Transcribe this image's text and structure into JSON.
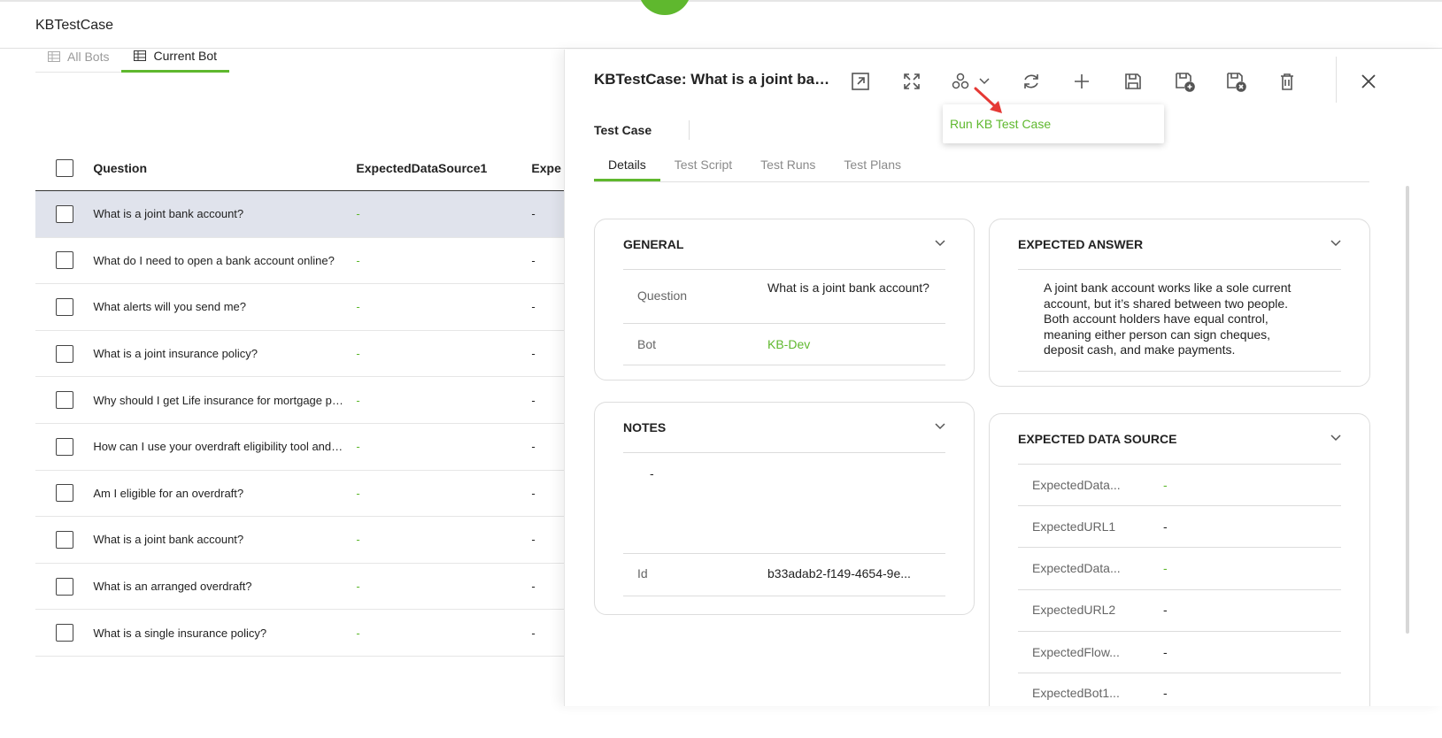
{
  "app": {
    "title": "KBTestCase"
  },
  "list": {
    "tabs": [
      {
        "label": "All Bots",
        "active": false
      },
      {
        "label": "Current Bot",
        "active": true
      }
    ],
    "columns": [
      "Question",
      "ExpectedDataSource1",
      "Expe"
    ],
    "rows": [
      {
        "question": "What is a joint bank account?",
        "ds1": "-",
        "expe": "-",
        "selected": true
      },
      {
        "question": "What do I need to open a bank account online?",
        "ds1": "-",
        "expe": "-"
      },
      {
        "question": "What alerts will you send me?",
        "ds1": "-",
        "expe": "-"
      },
      {
        "question": "What is a joint insurance policy?",
        "ds1": "-",
        "expe": "-"
      },
      {
        "question": "Why should I get Life insurance for mortgage protection?",
        "ds1": "-",
        "expe": "-"
      },
      {
        "question": "How can I use your overdraft eligibility tool and what does it do?",
        "ds1": "-",
        "expe": "-"
      },
      {
        "question": "Am I eligible for an overdraft?",
        "ds1": "-",
        "expe": "-"
      },
      {
        "question": "What is a joint bank account?",
        "ds1": "-",
        "expe": "-"
      },
      {
        "question": "What is an arranged overdraft?",
        "ds1": "-",
        "expe": "-"
      },
      {
        "question": "What is a single insurance policy?",
        "ds1": "-",
        "expe": "-"
      }
    ]
  },
  "panel": {
    "title": "KBTestCase: What is a joint bank account?",
    "subtitle": "Test Case",
    "toolbar_icons": [
      "open-external-icon",
      "expand-icon",
      "flow-icon",
      "refresh-icon",
      "add-icon",
      "save-icon",
      "save-add-icon",
      "save-close-icon",
      "delete-icon",
      "close-icon"
    ],
    "dropdown_item": "Run KB Test Case",
    "tabs": [
      {
        "label": "Details",
        "active": true
      },
      {
        "label": "Test Script"
      },
      {
        "label": "Test Runs"
      },
      {
        "label": "Test Plans"
      }
    ],
    "general": {
      "header": "GENERAL",
      "question_label": "Question",
      "question_value": "What is a joint bank account?",
      "bot_label": "Bot",
      "bot_value": "KB-Dev"
    },
    "notes": {
      "header": "NOTES",
      "value": "-",
      "id_label": "Id",
      "id_value": "b33adab2-f149-4654-9e..."
    },
    "expected_answer": {
      "header": "EXPECTED ANSWER",
      "text": "A joint bank account works like a sole current account, but it’s shared between two people. Both account holders have equal control, meaning either person can sign cheques, deposit cash, and make payments."
    },
    "expected_data_source": {
      "header": "EXPECTED DATA SOURCE",
      "rows": [
        {
          "label": "ExpectedData...",
          "value": "-"
        },
        {
          "label": "ExpectedURL1",
          "value": "-"
        },
        {
          "label": "ExpectedData...",
          "value": "-"
        },
        {
          "label": "ExpectedURL2",
          "value": "-"
        },
        {
          "label": "ExpectedFlow...",
          "value": "-"
        },
        {
          "label": "ExpectedBot1...",
          "value": "-"
        }
      ]
    }
  },
  "colors": {
    "accent": "#5fb82e",
    "selected_row": "#e0e3ec"
  }
}
